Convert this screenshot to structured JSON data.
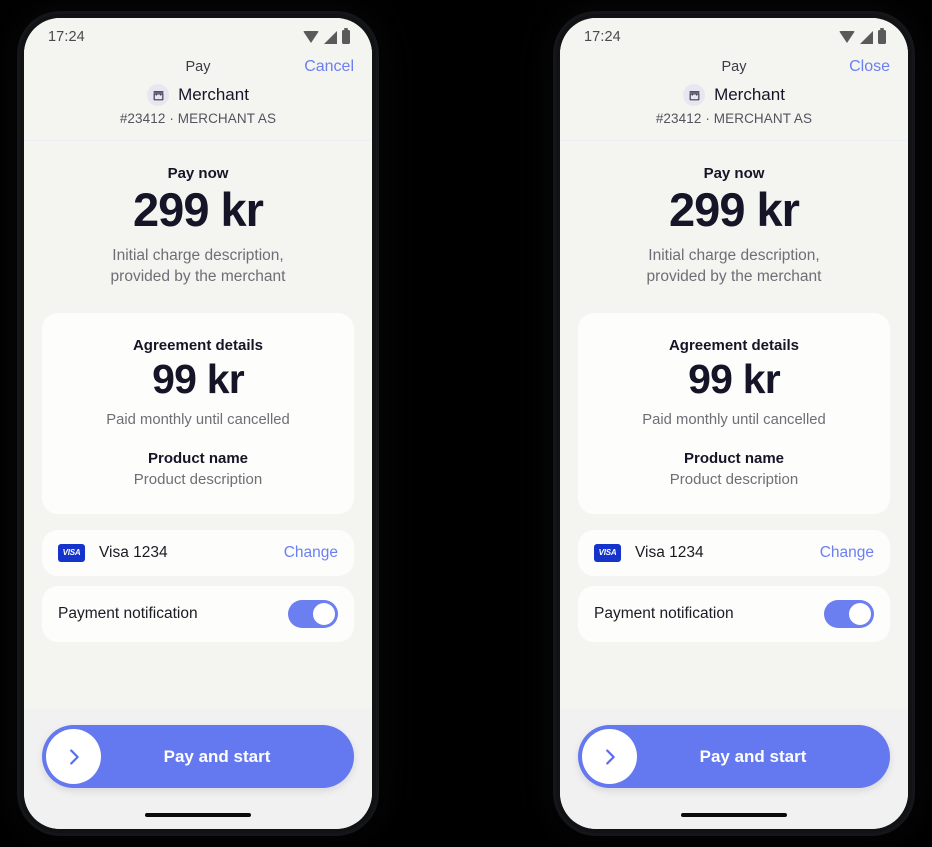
{
  "canvas": {
    "background": "#000000"
  },
  "theme": {
    "accent_blue": "#6478f0",
    "link_blue": "#6b7ff0",
    "visa_blue": "#1434cb",
    "screen_bg": "#f4f4f0",
    "card_bg": "#fdfdfc",
    "footer_bg": "#f1f1f2",
    "text_dark": "#151527",
    "text_muted": "#6e6e76"
  },
  "phones": [
    {
      "id": "phone-left",
      "status_bar": {
        "time": "17:24",
        "icons": [
          "wifi-icon",
          "cellular-signal-icon",
          "battery-icon"
        ]
      },
      "header": {
        "title": "Pay",
        "action_label": "Cancel",
        "merchant_icon": "storefront-icon",
        "merchant_name": "Merchant",
        "merchant_sub": "#23412 · MERCHANT AS"
      },
      "pay_now": {
        "label": "Pay now",
        "amount": "299 kr",
        "description_line1": "Initial charge description,",
        "description_line2": "provided by the merchant"
      },
      "agreement": {
        "title": "Agreement details",
        "amount": "99 kr",
        "period": "Paid monthly until cancelled",
        "product_name": "Product name",
        "product_description": "Product description"
      },
      "payment_method": {
        "brand_icon": "visa-card-icon",
        "brand_text": "VISA",
        "label": "Visa 1234",
        "change_label": "Change"
      },
      "notification": {
        "label": "Payment notification",
        "enabled": true
      },
      "cta": {
        "label": "Pay and start",
        "icon": "chevron-right-icon"
      }
    },
    {
      "id": "phone-right",
      "status_bar": {
        "time": "17:24",
        "icons": [
          "wifi-icon",
          "cellular-signal-icon",
          "battery-icon"
        ]
      },
      "header": {
        "title": "Pay",
        "action_label": "Close",
        "merchant_icon": "storefront-icon",
        "merchant_name": "Merchant",
        "merchant_sub": "#23412 · MERCHANT AS"
      },
      "pay_now": {
        "label": "Pay now",
        "amount": "299 kr",
        "description_line1": "Initial charge description,",
        "description_line2": "provided by the merchant"
      },
      "agreement": {
        "title": "Agreement details",
        "amount": "99 kr",
        "period": "Paid monthly until cancelled",
        "product_name": "Product name",
        "product_description": "Product description"
      },
      "payment_method": {
        "brand_icon": "visa-card-icon",
        "brand_text": "VISA",
        "label": "Visa 1234",
        "change_label": "Change"
      },
      "notification": {
        "label": "Payment notification",
        "enabled": true
      },
      "cta": {
        "label": "Pay and start",
        "icon": "chevron-right-icon"
      }
    }
  ]
}
